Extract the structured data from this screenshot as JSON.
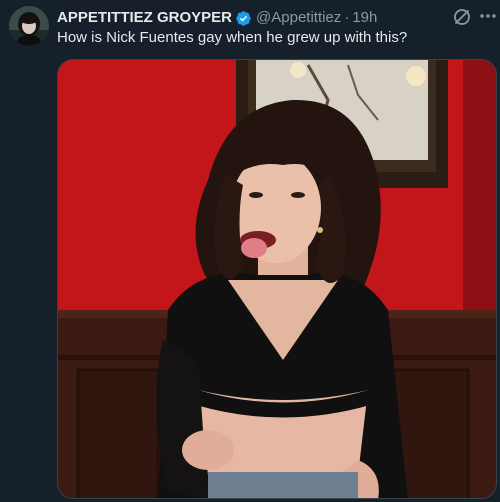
{
  "tweet": {
    "author": {
      "display_name": "APPETITTIEZ GROYPER",
      "handle": "@Appetittiez",
      "verified": true,
      "avatar_icon": "profile-photo"
    },
    "separator": "·",
    "time": "19h",
    "text": "How is Nick Fuentes gay when he grew up with this?",
    "media": {
      "type": "photo",
      "description_icon": "photo-of-woman"
    },
    "icons": {
      "grok": "grok-icon",
      "more": "more-icon",
      "verified": "verified-badge-icon"
    }
  },
  "colors": {
    "background": "#15202b",
    "text_primary": "#e7e9ea",
    "text_secondary": "#8b98a5",
    "verified_blue": "#1d9bf0",
    "border": "#38444d"
  }
}
